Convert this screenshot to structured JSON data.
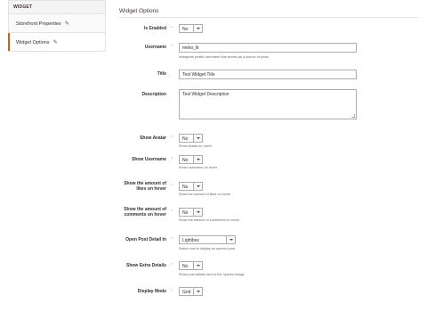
{
  "sidebar": {
    "header": "WIDGET",
    "items": [
      {
        "label": "Storefront Properties",
        "active": false
      },
      {
        "label": "Widget Options",
        "active": true
      }
    ]
  },
  "main": {
    "title": "Widget Options",
    "required_mark": "*",
    "fields": {
      "is_enabled": {
        "label": "Is Enabled",
        "value": "No"
      },
      "username": {
        "label": "Username",
        "value": "meko_lk",
        "note": "Instagram profile username that serves as a source of posts"
      },
      "title": {
        "label": "Title",
        "value": "Test Widget Title"
      },
      "description": {
        "label": "Description",
        "value": "Test Widget Description"
      },
      "show_avatar": {
        "label": "Show Avatar",
        "value": "No",
        "note": "Show avatar on hover"
      },
      "show_username": {
        "label": "Show Username",
        "value": "No",
        "note": "Show username on hover"
      },
      "show_likes": {
        "label": "Show the amount of likes on hover",
        "value": "No",
        "note": "Show the amount of likes on hover"
      },
      "show_comments": {
        "label": "Show the amount of comments on hover",
        "value": "No",
        "note": "Show the amount of comments on hover"
      },
      "open_post": {
        "label": "Open Post Detail In",
        "value": "Lightbox",
        "note": "Select how to display an opened post"
      },
      "extra_details": {
        "label": "Show Extra Details",
        "value": "No",
        "note": "Show post details next to the opened image"
      },
      "display_mode": {
        "label": "Display Mode",
        "value": "Grid"
      }
    }
  },
  "colors": {
    "accent": "#eb5202",
    "border": "#adadad"
  },
  "icons": {
    "edit": "pencil-icon",
    "dropdown": "chevron-down-icon"
  }
}
